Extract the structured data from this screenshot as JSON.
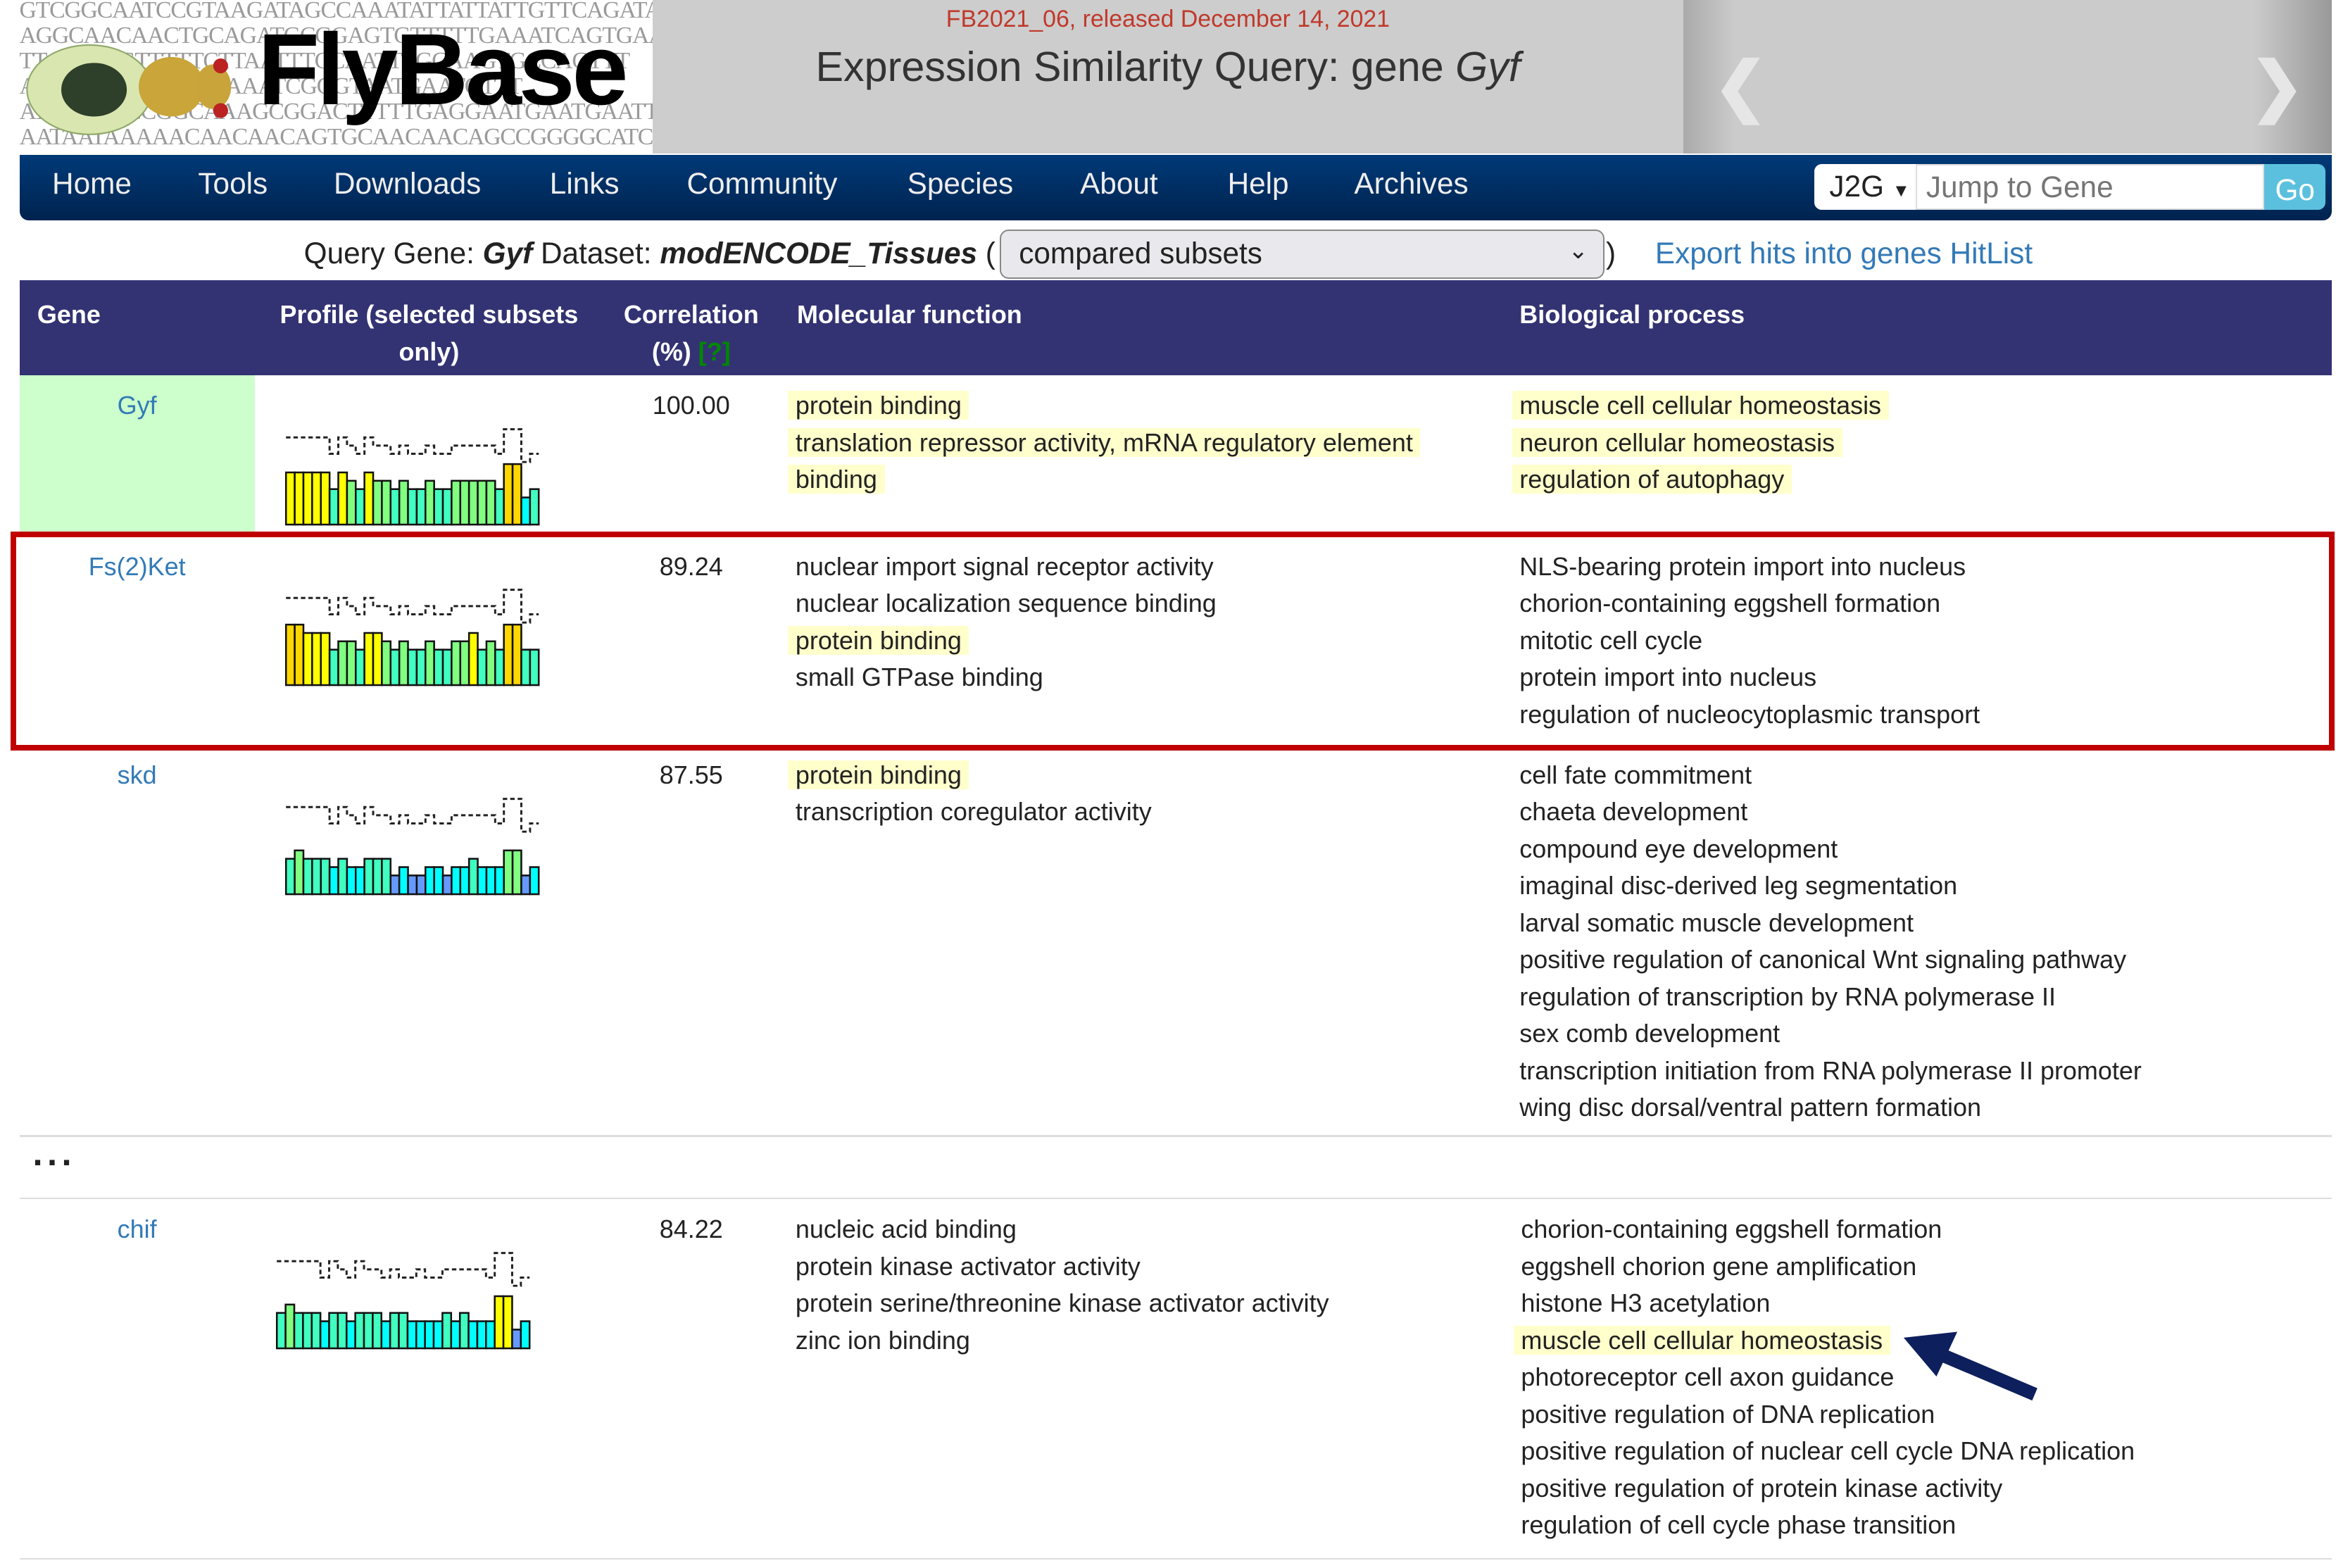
{
  "header": {
    "logo": {
      "text": "FlyBase",
      "dna_lines": [
        "GTCGGCAATCCGTAAGATAGCCAAATATTATTATTGTTCAGATACTCAC",
        "AGGCAACAACTGCAGATGCGGAGTGTTTTTGAAATCAGTGAAATT",
        "TTATCCAGTTTTTCTTAATTTCCAATTTGCAAGTGCCAGTTT",
        "ATCGATCGAATCTGAAATCGGGTAATGAATGTTT",
        "ATTGAAGCCGGCAAAGCGGACTTTTTGAGGAATGAATGAATTAAAGGAA",
        "AATAATAAAAACAACAACAGTGCAACAACAGCCGGGGCATCTTCATAGA"
      ]
    },
    "release": "FB2021_06, released December 14, 2021",
    "title_prefix": "Expression Similarity Query: gene ",
    "title_gene": "Gyf"
  },
  "nav": {
    "items": [
      "Home",
      "Tools",
      "Downloads",
      "Links",
      "Community",
      "Species",
      "About",
      "Help",
      "Archives"
    ],
    "j2g_label": "J2G",
    "jump_placeholder": "Jump to Gene",
    "go_label": "Go"
  },
  "query": {
    "gene_label": "Query Gene:",
    "gene": "Gyf",
    "dataset_label": "Dataset:",
    "dataset": "modENCODE_Tissues",
    "open_paren": "(",
    "close_paren": ")",
    "subset_select": "compared subsets",
    "export_link": "Export hits into genes HitList"
  },
  "table": {
    "headers": {
      "gene": "Gene",
      "profile_1": "Profile (selected subsets",
      "profile_2": "only)",
      "corr_1": "Correlation",
      "corr_2": "(%)",
      "help": "[?]",
      "molecular": "Molecular function",
      "biological": "Biological process"
    },
    "ellipsis": "...",
    "level_colors": {
      "1": "#6699ff",
      "2": "#00ffff",
      "3": "#40ffc0",
      "4": "#80ff80",
      "5": "#ffff00",
      "6": "#ffd700"
    },
    "rows": [
      {
        "gene": "Gyf",
        "correlation": "100.00",
        "query_row": true,
        "profile": [
          5,
          5,
          5,
          5,
          5,
          3,
          5,
          4,
          3,
          5,
          4,
          4,
          3,
          4,
          3,
          3,
          4,
          3,
          3,
          4,
          4,
          4,
          4,
          4,
          3,
          6,
          6,
          2,
          3
        ],
        "molecular": [
          {
            "t": "protein binding",
            "hl": true
          },
          {
            "t": "translation repressor activity, mRNA regulatory element",
            "hl": true
          },
          {
            "t": "binding",
            "hl": true
          }
        ],
        "biological": [
          {
            "t": "muscle cell cellular homeostasis",
            "hl": true
          },
          {
            "t": "neuron cellular homeostasis",
            "hl": true
          },
          {
            "t": "regulation of autophagy",
            "hl": true
          }
        ]
      },
      {
        "gene": "Fs(2)Ket",
        "correlation": "89.24",
        "highlighted_box": true,
        "profile": [
          6,
          6,
          5,
          5,
          5,
          3,
          4,
          4,
          3,
          5,
          5,
          4,
          3,
          4,
          3,
          3,
          4,
          3,
          3,
          4,
          4,
          5,
          3,
          4,
          3,
          6,
          6,
          3,
          3
        ],
        "molecular": [
          {
            "t": "nuclear import signal receptor activity"
          },
          {
            "t": "nuclear localization sequence binding"
          },
          {
            "t": "protein binding",
            "hl": true
          },
          {
            "t": "small GTPase binding"
          }
        ],
        "biological": [
          {
            "t": "NLS-bearing protein import into nucleus"
          },
          {
            "t": "chorion-containing eggshell formation"
          },
          {
            "t": "mitotic cell cycle"
          },
          {
            "t": "protein import into nucleus"
          },
          {
            "t": "regulation of nucleocytoplasmic transport"
          }
        ]
      },
      {
        "gene": "skd",
        "correlation": "87.55",
        "profile": [
          3,
          4,
          3,
          3,
          3,
          2,
          3,
          2,
          2,
          3,
          3,
          3,
          1,
          2,
          1,
          1,
          2,
          2,
          1,
          2,
          2,
          3,
          2,
          2,
          2,
          4,
          4,
          1,
          2
        ],
        "molecular": [
          {
            "t": "protein binding",
            "hl": true
          },
          {
            "t": "transcription coregulator activity"
          }
        ],
        "biological": [
          {
            "t": "cell fate commitment"
          },
          {
            "t": "chaeta development"
          },
          {
            "t": "compound eye development"
          },
          {
            "t": "imaginal disc-derived leg segmentation"
          },
          {
            "t": "larval somatic muscle development"
          },
          {
            "t": "positive regulation of canonical Wnt signaling pathway"
          },
          {
            "t": "regulation of transcription by RNA polymerase II"
          },
          {
            "t": "sex comb development"
          },
          {
            "t": "transcription initiation from RNA polymerase II promoter"
          },
          {
            "t": "wing disc dorsal/ventral pattern formation"
          }
        ]
      },
      {
        "gene": "chif",
        "correlation": "84.22",
        "profile": [
          3,
          4,
          3,
          3,
          3,
          2,
          3,
          3,
          2,
          3,
          3,
          3,
          2,
          3,
          3,
          2,
          2,
          2,
          2,
          3,
          2,
          3,
          2,
          2,
          2,
          5,
          5,
          1,
          2
        ],
        "molecular": [
          {
            "t": "nucleic acid binding"
          },
          {
            "t": "protein kinase activator activity"
          },
          {
            "t": "protein serine/threonine kinase activator activity"
          },
          {
            "t": "zinc ion binding"
          }
        ],
        "biological": [
          {
            "t": "chorion-containing eggshell formation"
          },
          {
            "t": "eggshell chorion gene amplification"
          },
          {
            "t": "histone H3 acetylation"
          },
          {
            "t": "muscle cell cellular homeostasis",
            "hl": true,
            "arrow": true
          },
          {
            "t": "photoreceptor cell axon guidance"
          },
          {
            "t": "positive regulation of DNA replication"
          },
          {
            "t": "positive regulation of nuclear cell cycle DNA replication"
          },
          {
            "t": "positive regulation of protein kinase activity"
          },
          {
            "t": "regulation of cell cycle phase transition"
          }
        ]
      }
    ]
  },
  "annotations": {
    "box_color": "#c00000",
    "arrow_color": "#0d1f5c"
  }
}
